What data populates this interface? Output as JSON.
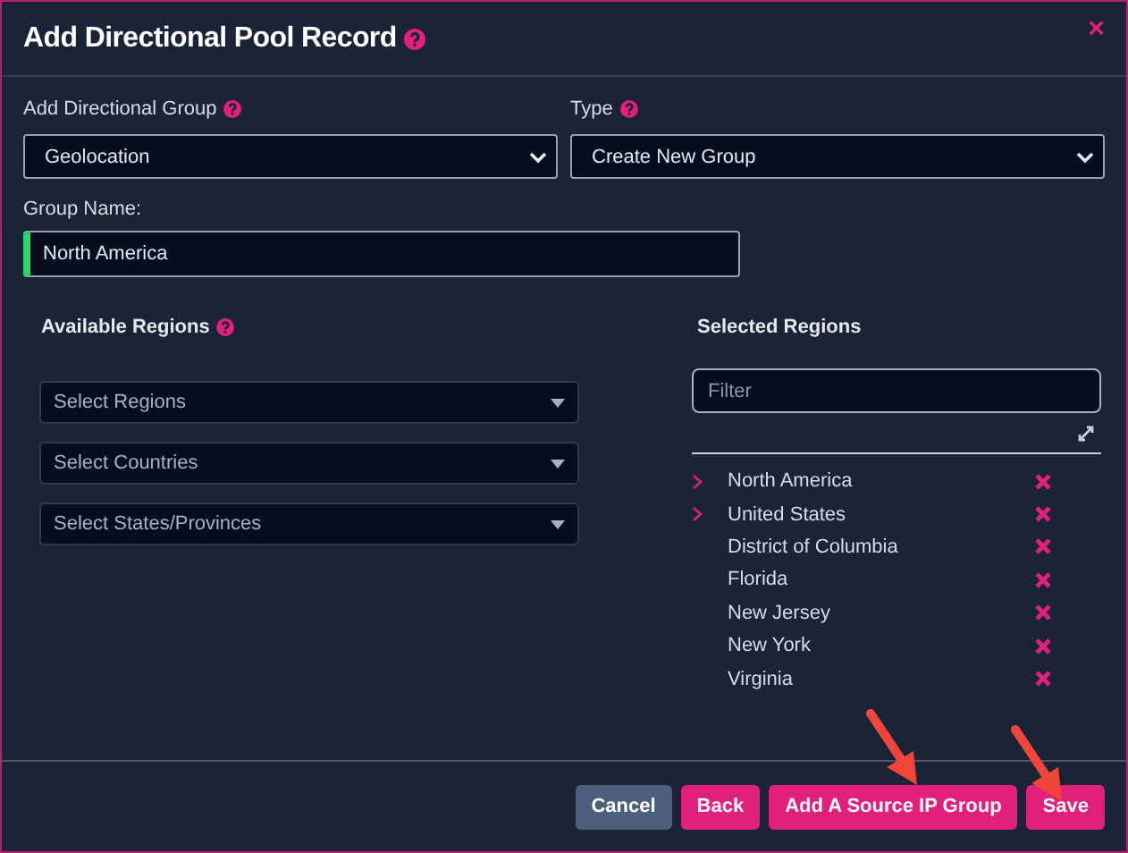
{
  "dialog": {
    "title": "Add Directional Pool Record",
    "close": "×"
  },
  "group_select": {
    "label": "Add Directional Group",
    "value": "Geolocation"
  },
  "type_select": {
    "label": "Type",
    "value": "Create New Group"
  },
  "group_name": {
    "label": "Group Name:",
    "value": "North America"
  },
  "available_regions": {
    "label": "Available Regions",
    "selects": [
      {
        "placeholder": "Select Regions"
      },
      {
        "placeholder": "Select Countries"
      },
      {
        "placeholder": "Select States/Provinces"
      }
    ]
  },
  "selected_regions": {
    "label": "Selected Regions",
    "filter": {
      "placeholder": "Filter"
    },
    "items": [
      {
        "name": "North America",
        "children": [
          {
            "name": "United States",
            "children": [
              {
                "name": "District of Columbia"
              },
              {
                "name": "Florida"
              },
              {
                "name": "New Jersey"
              },
              {
                "name": "New York"
              },
              {
                "name": "Virginia"
              }
            ]
          }
        ]
      }
    ]
  },
  "buttons": [
    {
      "label": "Cancel",
      "kind": "secondary"
    },
    {
      "label": "Back",
      "kind": "primary"
    },
    {
      "label": "Add A Source IP Group",
      "kind": "primary"
    },
    {
      "label": "Save",
      "kind": "primary"
    }
  ]
}
